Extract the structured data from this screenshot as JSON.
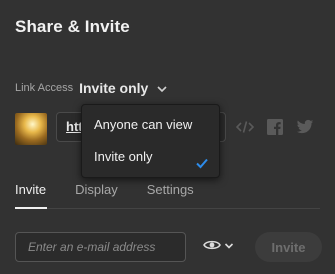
{
  "dialog": {
    "title": "Share & Invite"
  },
  "link_access": {
    "label": "Link Access",
    "value": "Invite only"
  },
  "link": {
    "url_visible": "http"
  },
  "share_icons": [
    "embed-code-icon",
    "facebook-icon",
    "twitter-icon"
  ],
  "access_menu": {
    "options": [
      "Anyone can view",
      "Invite only"
    ],
    "selected": "Invite only"
  },
  "tabs": [
    {
      "label": "Invite",
      "active": true
    },
    {
      "label": "Display",
      "active": false
    },
    {
      "label": "Settings",
      "active": false
    }
  ],
  "invite": {
    "email_placeholder": "Enter an e-mail address",
    "permission_icon": "eye-icon",
    "button_label": "Invite",
    "button_enabled": false
  },
  "colors": {
    "background": "#323232",
    "accent_check": "#2d8ceb",
    "text_primary": "#e8e8e8",
    "text_muted": "#a6a6a6"
  }
}
